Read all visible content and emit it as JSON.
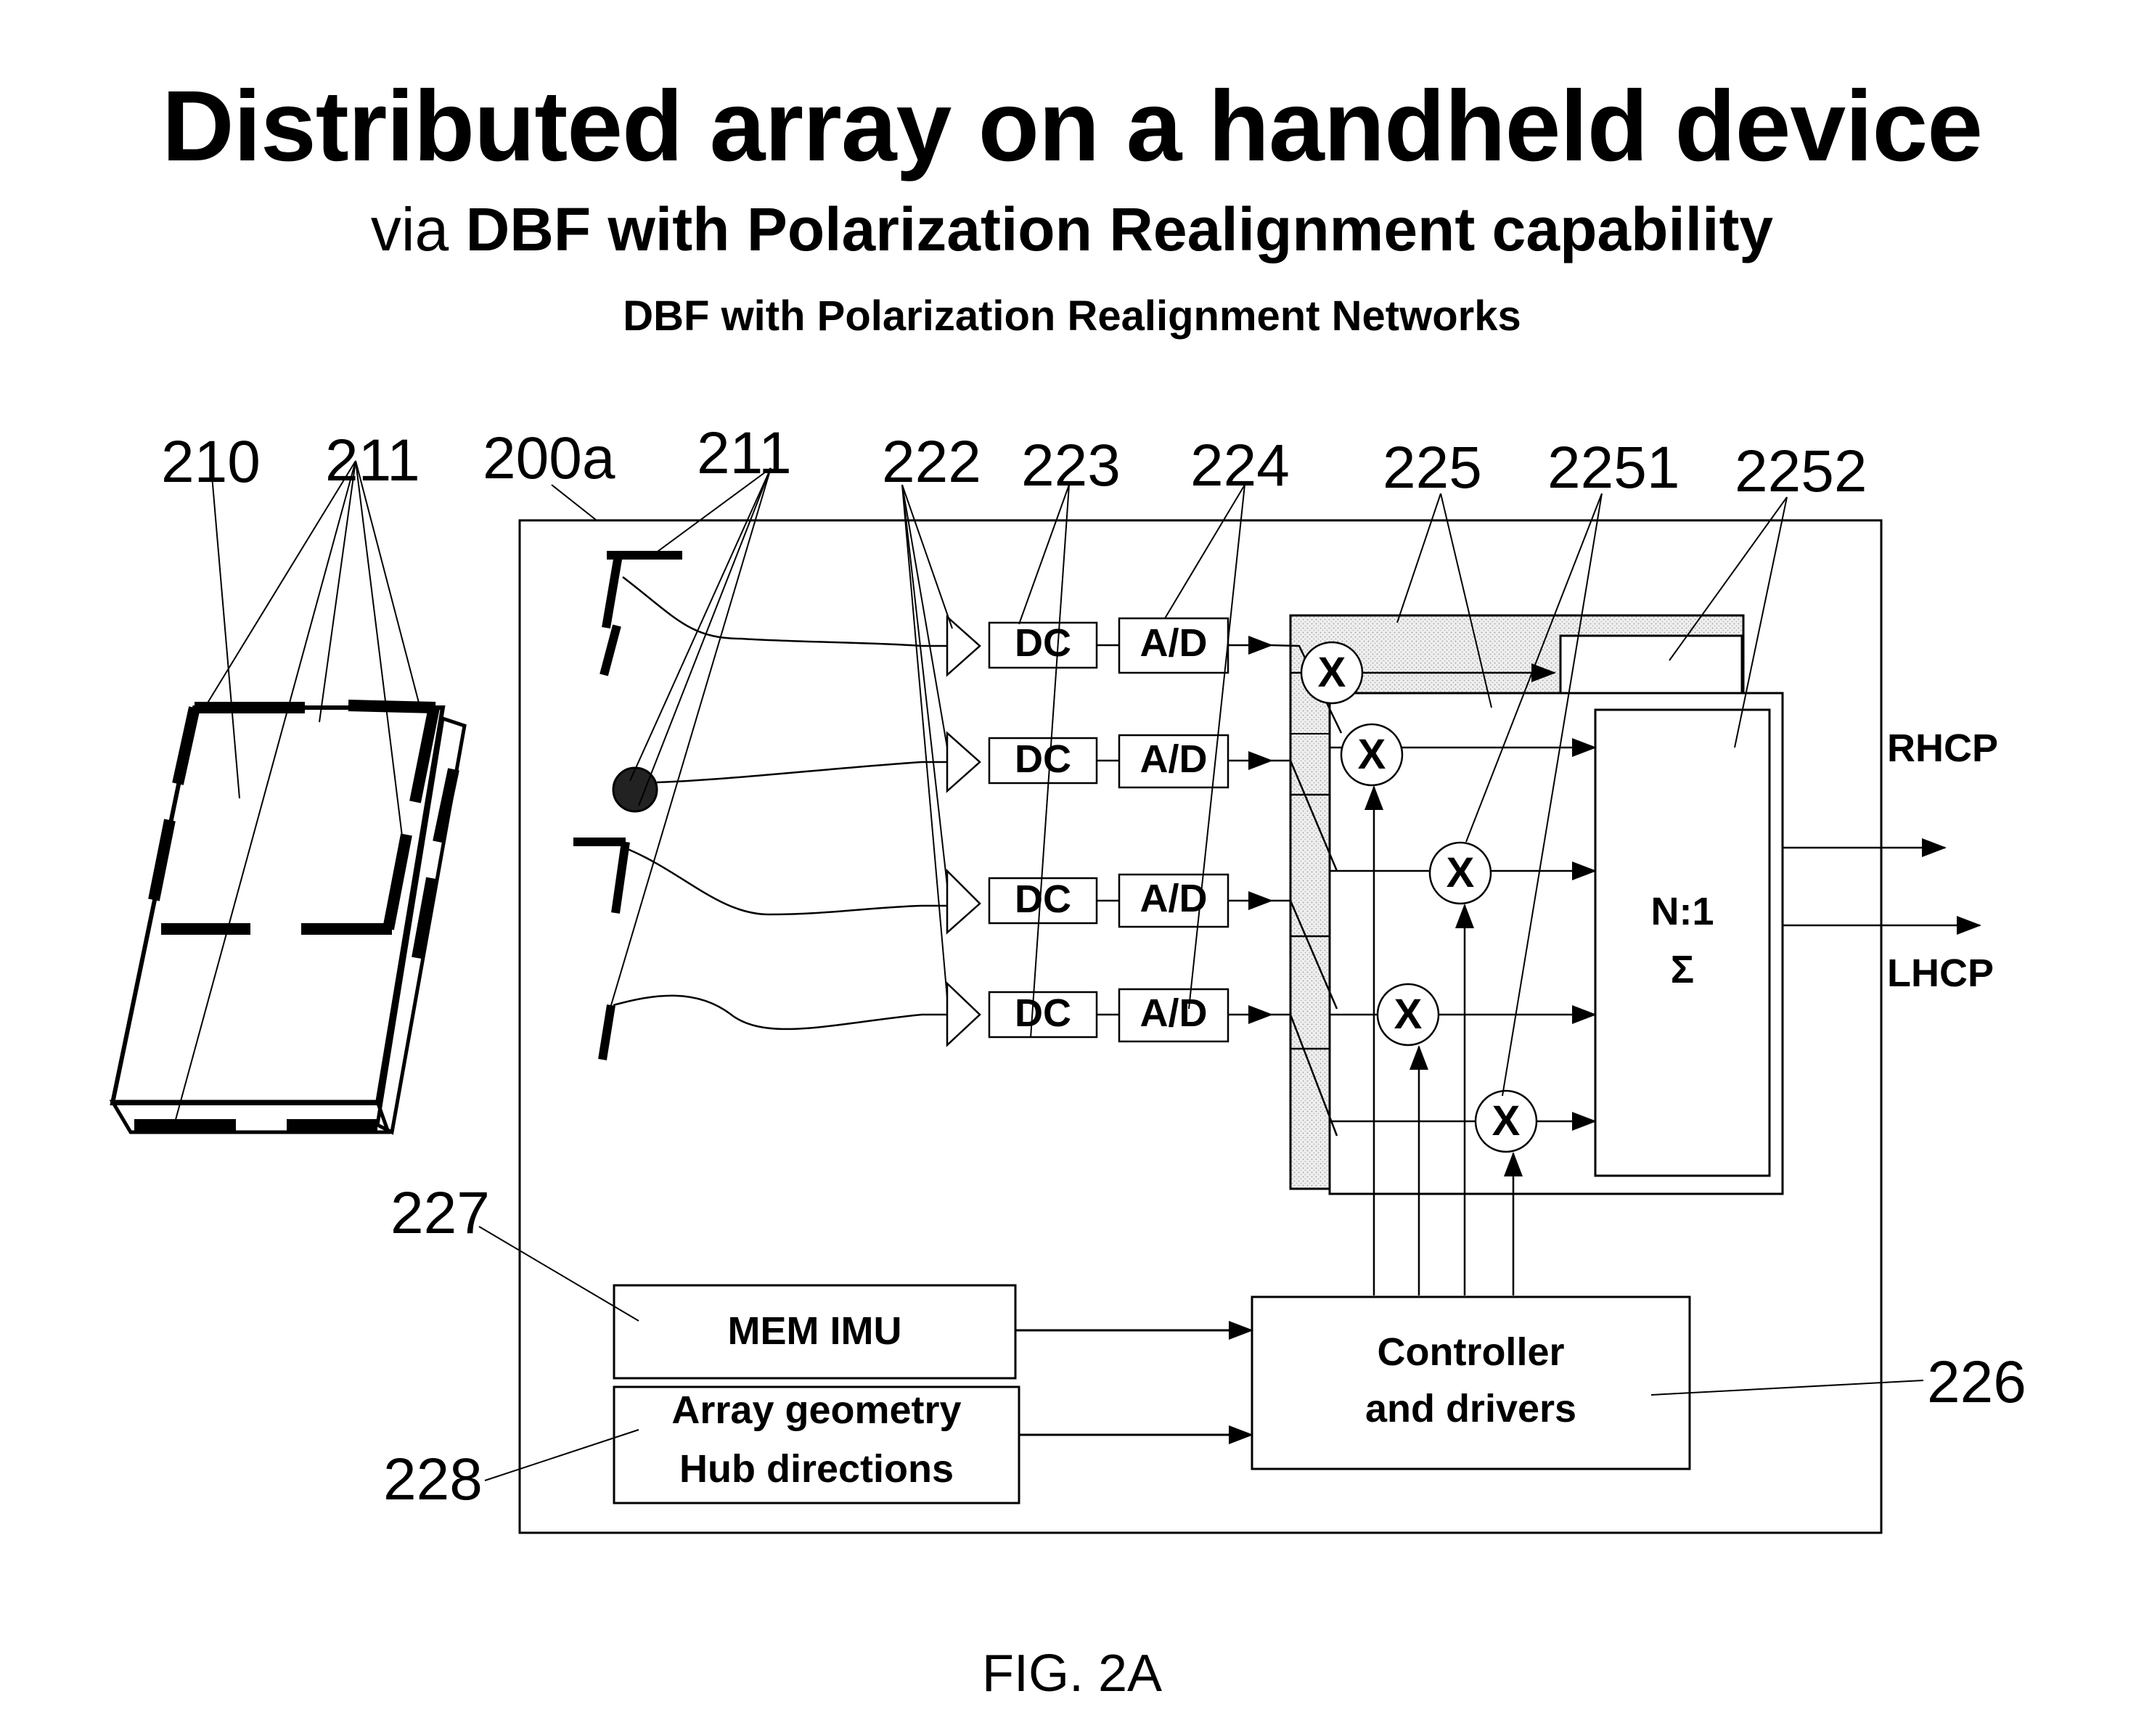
{
  "header": {
    "title": "Distributed array on a handheld device",
    "subtitle_prefix": "via ",
    "subtitle_bold": "DBF with Polarization Realignment capability",
    "subsubtitle": "DBF with Polarization Realignment Networks"
  },
  "reference_numerals": {
    "r210": "210",
    "r211_left": "211",
    "r200a": "200a",
    "r211_mid": "211",
    "r222": "222",
    "r223": "223",
    "r224": "224",
    "r225": "225",
    "r2251": "2251",
    "r2252": "2252",
    "r227": "227",
    "r228": "228",
    "r226": "226"
  },
  "blocks": {
    "dc": [
      "DC",
      "DC",
      "DC",
      "DC"
    ],
    "ad": [
      "A/D",
      "A/D",
      "A/D",
      "A/D"
    ],
    "multiplier_symbol": "X",
    "combiner_line1": "N:1",
    "combiner_line2": "Σ",
    "mem_imu": "MEM IMU",
    "array_geometry_line1": "Array geometry",
    "array_geometry_line2": "Hub directions",
    "controller_line1": "Controller",
    "controller_line2": "and drivers"
  },
  "outputs": {
    "rhcp": "RHCP",
    "lhcp": "LHCP"
  },
  "caption": "FIG. 2A"
}
